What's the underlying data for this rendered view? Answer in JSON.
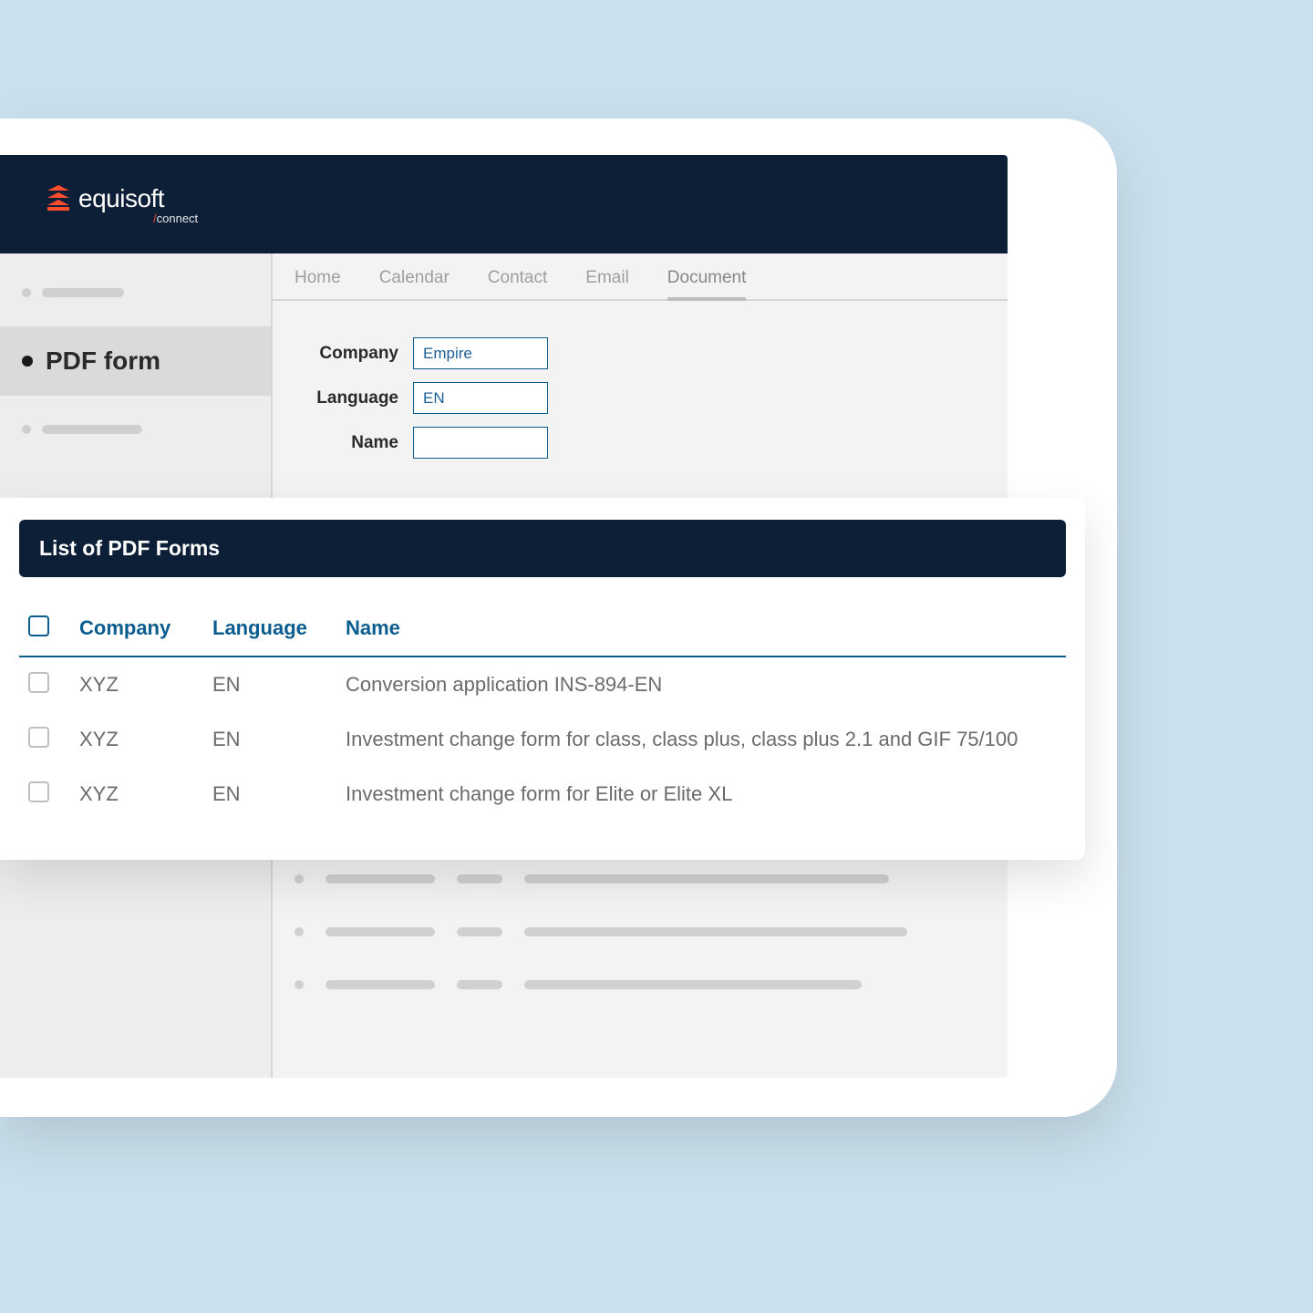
{
  "brand": {
    "name": "equisoft",
    "sub": "connect",
    "slash": "/"
  },
  "sidebar": {
    "active_label": "PDF form"
  },
  "tabs": [
    {
      "label": "Home"
    },
    {
      "label": "Calendar"
    },
    {
      "label": "Contact"
    },
    {
      "label": "Email"
    },
    {
      "label": "Document"
    }
  ],
  "filters": {
    "company": {
      "label": "Company",
      "value": "Empire"
    },
    "language": {
      "label": "Language",
      "value": "EN"
    },
    "name": {
      "label": "Name",
      "value": ""
    }
  },
  "card": {
    "title": "List of PDF Forms",
    "columns": {
      "company": "Company",
      "language": "Language",
      "name": "Name"
    },
    "rows": [
      {
        "company": "XYZ",
        "language": "EN",
        "name": "Conversion application INS-894-EN"
      },
      {
        "company": "XYZ",
        "language": "EN",
        "name": "Investment change form for class, class plus, class plus 2.1 and GIF 75/100"
      },
      {
        "company": "XYZ",
        "language": "EN",
        "name": "Investment change form for Elite or Elite XL"
      }
    ]
  }
}
